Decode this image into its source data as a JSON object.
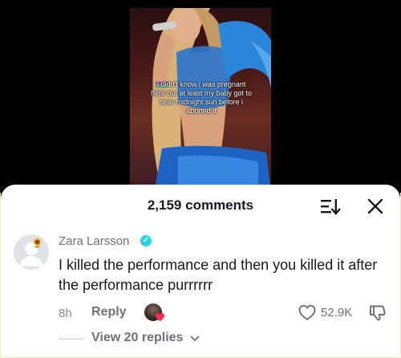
{
  "video": {
    "caption": "I didn't know i was pregnant here but at least my baby got to hear midnight sun before i aborted it"
  },
  "comments_panel": {
    "count_label": "2,159 comments",
    "sort_icon": "sort-icon",
    "close_icon": "close-icon"
  },
  "comment": {
    "author": "Zara Larsson",
    "avatar_decoration": "🌻",
    "verified": true,
    "verified_glyph": "✓",
    "text": "I killed the performance and then you killed it after the performance purrrrrr",
    "time": "8h",
    "reply_label": "Reply",
    "likes": "52.9K",
    "view_replies_label": "View 20 replies"
  },
  "colors": {
    "accent_verified": "#20d5ec",
    "heart_red": "#fe2c55"
  }
}
